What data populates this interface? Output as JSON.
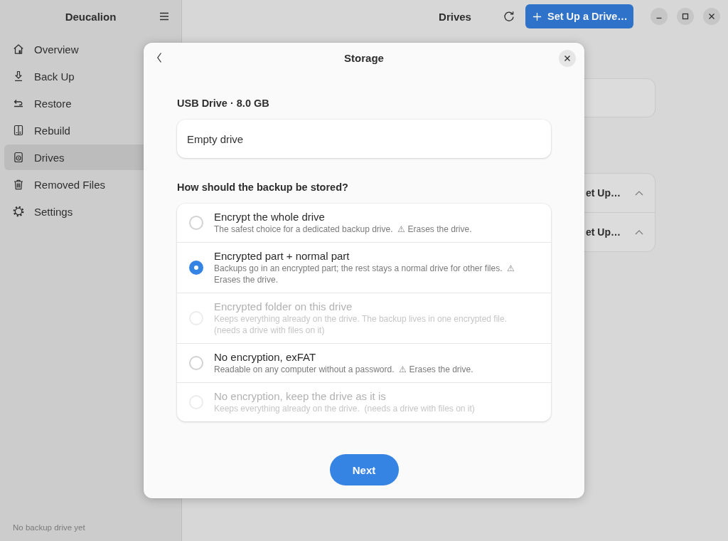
{
  "sidebar": {
    "title": "Deucalion",
    "items": [
      {
        "label": "Overview",
        "selected": false
      },
      {
        "label": "Back Up",
        "selected": false
      },
      {
        "label": "Restore",
        "selected": false
      },
      {
        "label": "Rebuild",
        "selected": false
      },
      {
        "label": "Drives",
        "selected": true
      },
      {
        "label": "Removed Files",
        "selected": false
      },
      {
        "label": "Settings",
        "selected": false
      }
    ],
    "footer": "No backup drive yet"
  },
  "header": {
    "title": "Drives",
    "primary_button": "Set Up a Drive…"
  },
  "drive_list": {
    "rows": [
      {
        "label": "et Up…"
      },
      {
        "label": "et Up…"
      }
    ]
  },
  "dialog": {
    "title": "Storage",
    "drive_heading": "USB Drive · 8.0 GB",
    "drive_status": "Empty drive",
    "question": "How should the backup be stored?",
    "options": [
      {
        "title": "Encrypt the whole drive",
        "description": "The safest choice for a dedicated backup drive.  ⚠ Erases the drive.",
        "selected": false,
        "disabled": false
      },
      {
        "title": "Encrypted part + normal part",
        "description": "Backups go in an encrypted part; the rest stays a normal drive for other files.  ⚠ Erases the drive.",
        "selected": true,
        "disabled": false
      },
      {
        "title": "Encrypted folder on this drive",
        "description": "Keeps everything already on the drive. The backup lives in one encrypted file. (needs a drive with files on it)",
        "selected": false,
        "disabled": true
      },
      {
        "title": "No encryption, exFAT",
        "description": "Readable on any computer without a password.  ⚠ Erases the drive.",
        "selected": false,
        "disabled": false
      },
      {
        "title": "No encryption, keep the drive as it is",
        "description": "Keeps everything already on the drive.  (needs a drive with files on it)",
        "selected": false,
        "disabled": true
      }
    ],
    "next_button": "Next"
  }
}
